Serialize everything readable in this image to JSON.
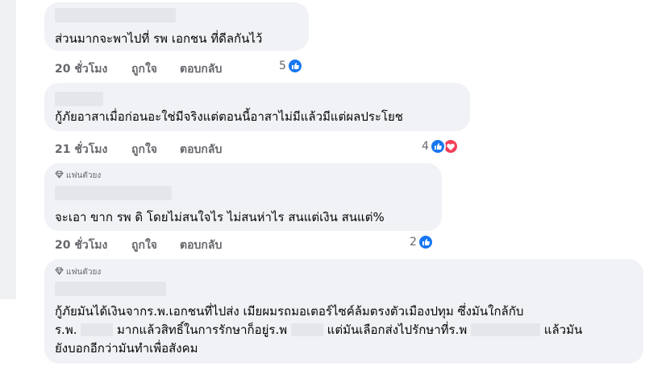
{
  "comments": [
    {
      "text": "ส่วนมากจะพาไปที่ รพ เอกชน ที่ดีลกันไว้",
      "time": "20 ชั่วโมง",
      "like_label": "ถูกใจ",
      "reply_label": "ตอบกลับ",
      "reaction_count": "5",
      "reactions": [
        "like-icon"
      ]
    },
    {
      "text": "กู้ภัยอาสาเมื่อก่อนอะใช่มีจริงแต่ตอนนี้อาสาไม่มีแล้วมีแต่ผลประโยช",
      "time": "21 ชั่วโมง",
      "like_label": "ถูกใจ",
      "reply_label": "ตอบกลับ",
      "reaction_count": "4",
      "reactions": [
        "like-icon",
        "love-icon"
      ]
    },
    {
      "badge": "แฟนตัวยง",
      "text": "จะเอา ขาก รพ ดิ โดยไม่สนใจไร ไม่สนห่าไร สนแต่เงิน สนแต่%",
      "time": "20 ชั่วโมง",
      "like_label": "ถูกใจ",
      "reply_label": "ตอบกลับ",
      "reaction_count": "2",
      "reactions": [
        "like-icon"
      ]
    },
    {
      "badge": "แฟนตัวยง",
      "line1": "กู้ภัยมันได้เงินจากร.พ.เอกชนที่ไปส่ง เมียผมรถมอเตอร์ไซค์ล้มตรงตัวเมืองปทุม ซึ่งมันใกล้กับ",
      "line2_a": "ร.พ.",
      "line2_b": "มากแล้วสิทธิ์ในการรักษาก็อยู่ร.พ",
      "line2_c": "แต่มันเลือกส่งไปรักษาที่ร.พ",
      "line2_d": "แล้วมัน",
      "line3": "ยังบอกอีกว่ามันทำเพื่อสังคม"
    }
  ],
  "colors": {
    "like_blue": "#1877f2",
    "love_red": "#f33e58",
    "bubble": "#f0f2f5",
    "meta": "#65676b"
  }
}
